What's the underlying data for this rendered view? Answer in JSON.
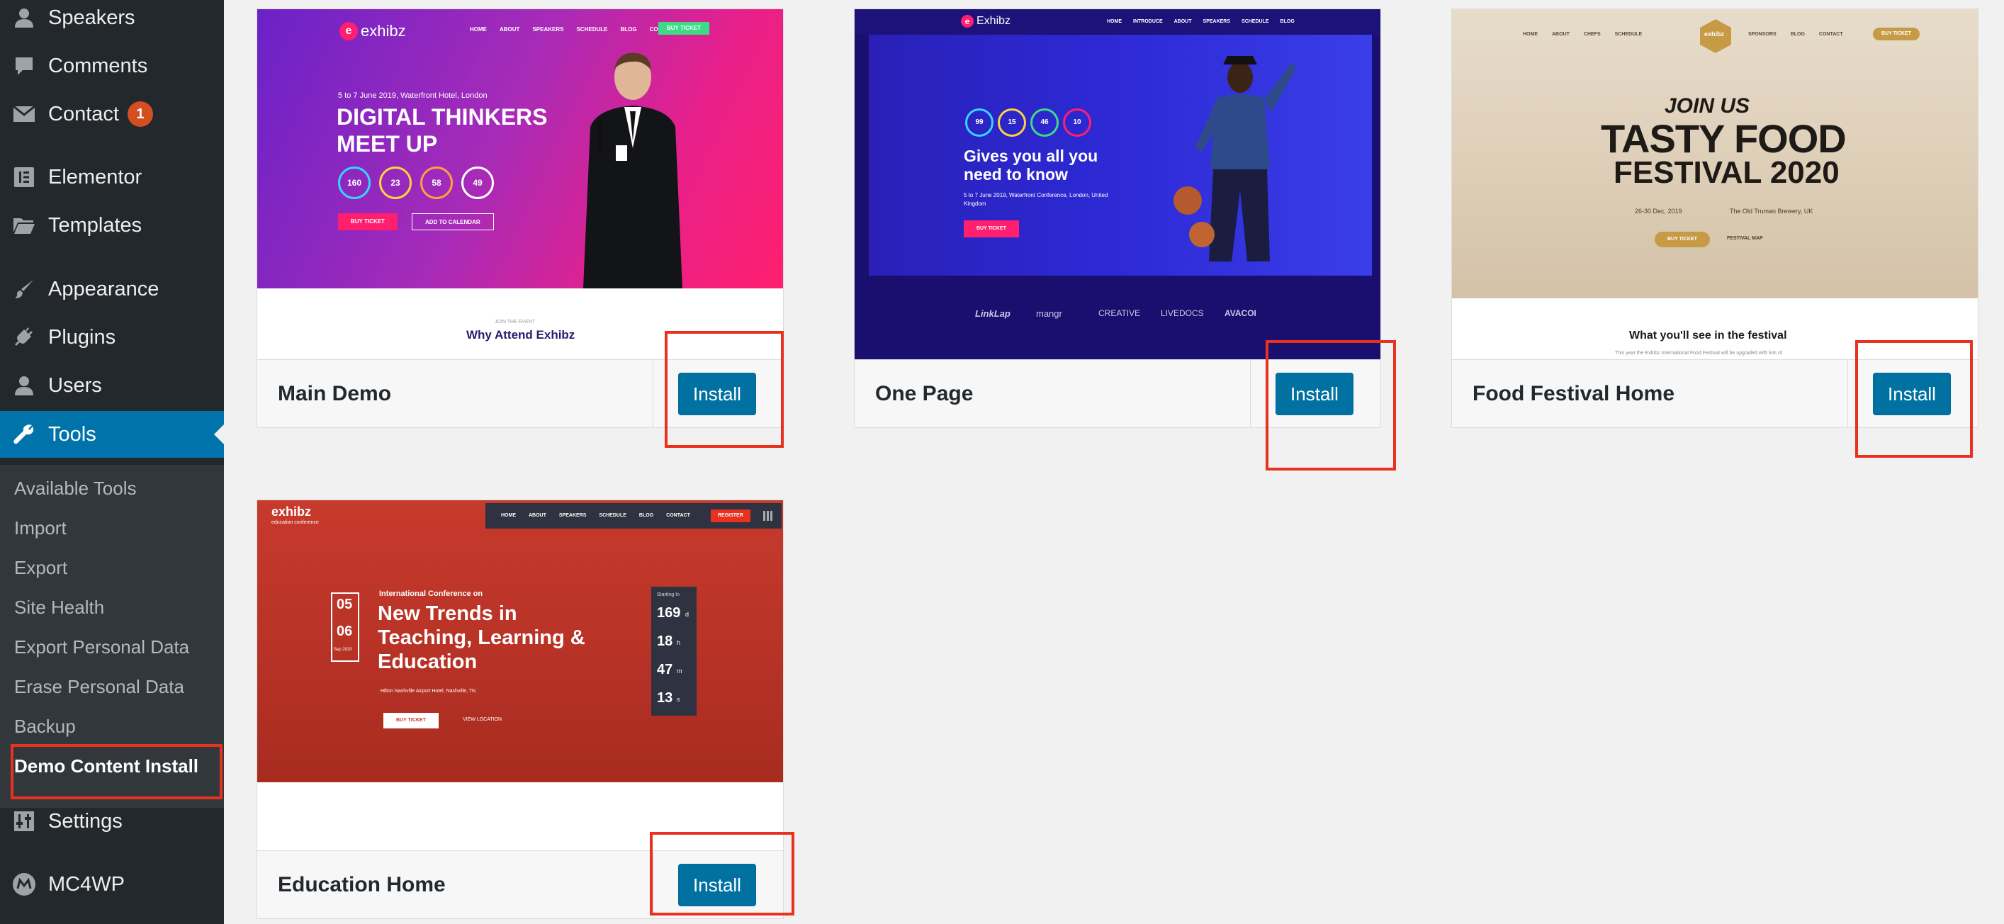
{
  "sidebar": {
    "items": [
      {
        "label": "Speakers",
        "icon": "person-icon"
      },
      {
        "label": "Comments",
        "icon": "comment-icon"
      },
      {
        "label": "Contact",
        "icon": "envelope-icon",
        "badge": "1"
      },
      {
        "label": "Elementor",
        "icon": "elementor-icon"
      },
      {
        "label": "Templates",
        "icon": "folder-icon"
      },
      {
        "label": "Appearance",
        "icon": "paintbrush-icon"
      },
      {
        "label": "Plugins",
        "icon": "plug-icon"
      },
      {
        "label": "Users",
        "icon": "person-icon"
      },
      {
        "label": "Tools",
        "icon": "wrench-icon",
        "current": true
      },
      {
        "label": "Settings",
        "icon": "sliders-icon"
      },
      {
        "label": "MC4WP",
        "icon": "mc4wp-icon"
      }
    ],
    "submenu": [
      {
        "label": "Available Tools"
      },
      {
        "label": "Import"
      },
      {
        "label": "Export"
      },
      {
        "label": "Site Health"
      },
      {
        "label": "Export Personal Data"
      },
      {
        "label": "Erase Personal Data"
      },
      {
        "label": "Backup"
      },
      {
        "label": "Demo Content Install",
        "active": true
      }
    ]
  },
  "demos": [
    {
      "title": "Main Demo",
      "button": "Install",
      "preview": {
        "logo": "exhibz",
        "nav": [
          "HOME",
          "ABOUT",
          "SPEAKERS",
          "SCHEDULE",
          "BLOG",
          "CONTACT"
        ],
        "cta": "BUY TICKET",
        "date_line": "5 to 7 June 2019, Waterfront Hotel, London",
        "headline_1": "DIGITAL THINKERS",
        "headline_2": "MEET UP",
        "counters": [
          "160",
          "23",
          "58",
          "49"
        ],
        "btn_1": "BUY TICKET",
        "btn_2": "ADD TO CALENDAR",
        "section_kicker": "JOIN THE EVENT",
        "section_title": "Why Attend Exhibz"
      }
    },
    {
      "title": "One Page",
      "button": "Install",
      "preview": {
        "logo": "Exhibz",
        "nav": [
          "HOME",
          "INTRODUCE",
          "ABOUT",
          "SPEAKERS",
          "SCHEDULE",
          "BLOG"
        ],
        "counters": [
          "99",
          "15",
          "46",
          "10"
        ],
        "headline_1": "Gives you all you",
        "headline_2": "need to know",
        "sub_1": "5 to 7 June 2019, Waterfront Conference, London, United",
        "sub_2": "Kingdom",
        "btn": "BUY TICKET",
        "sponsors": [
          "LinkLap",
          "mangr",
          "CREATIVE",
          "LIVEDOCS",
          "AVACOI"
        ]
      }
    },
    {
      "title": "Food Festival Home",
      "button": "Install",
      "preview": {
        "nav_left": [
          "HOME",
          "ABOUT",
          "CHEFS",
          "SCHEDULE"
        ],
        "nav_right": [
          "SPONSORS",
          "BLOG",
          "CONTACT"
        ],
        "nav_btn": "BUY TICKET",
        "logo": "exhibz",
        "join": "JOIN US",
        "headline_1": "TASTY FOOD",
        "headline_2": "FESTIVAL 2020",
        "date": "26-30 Dec, 2019",
        "venue": "The Old Truman Brewery, UK",
        "btn": "BUY TICKET",
        "map": "FESTIVAL MAP",
        "section_title": "What you'll see in the festival",
        "section_sub": "This year the Exhibz International Food Festival will be upgraded with lots of"
      }
    },
    {
      "title": "Education Home",
      "button": "Install",
      "preview": {
        "logo": "exhibz",
        "logo_sub": "education conference",
        "nav": [
          "HOME",
          "ABOUT",
          "SPEAKERS",
          "SCHEDULE",
          "BLOG",
          "CONTACT"
        ],
        "nav_btn": "REGISTER",
        "date_top": "05",
        "date_bottom": "06",
        "date_month": "Sep 2020",
        "kicker": "International Conference on",
        "headline_1": "New Trends in",
        "headline_2": "Teaching, Learning &",
        "headline_3": "Education",
        "venue": "Hilton Nashville Airport Hotel, Nashville, TN",
        "btn": "BUY TICKET",
        "link": "VIEW LOCATION",
        "countdown_label": "Starting In",
        "countdown": [
          {
            "value": "169",
            "unit": "d"
          },
          {
            "value": "18",
            "unit": "h"
          },
          {
            "value": "47",
            "unit": "m"
          },
          {
            "value": "13",
            "unit": "s"
          }
        ]
      }
    }
  ],
  "colors": {
    "sidebar_bg": "#23282d",
    "submenu_bg": "#32373c",
    "current_menu": "#0073aa",
    "install_button": "#0071a1",
    "highlight_box": "#e8311e",
    "page_bg": "#f1f1f1"
  }
}
